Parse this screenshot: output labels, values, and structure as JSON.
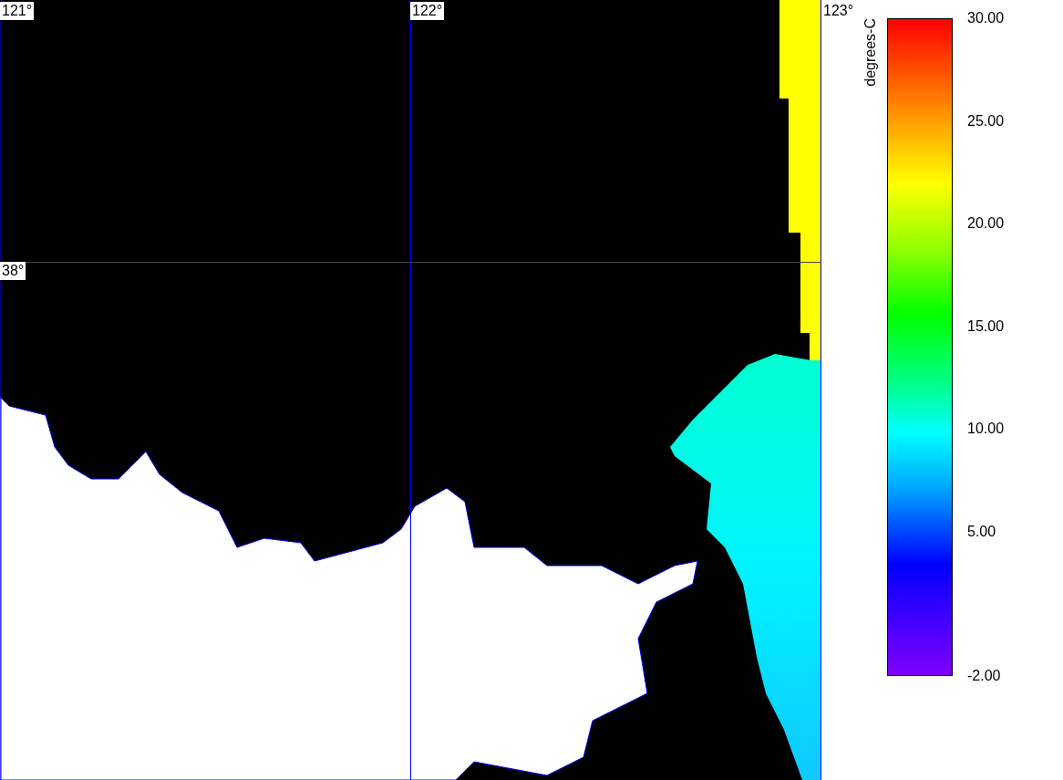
{
  "map": {
    "longitude_labels": [
      "121°",
      "122°",
      "123°"
    ],
    "latitude_labels": [
      "38°"
    ]
  },
  "color_scale": {
    "unit": "degrees-C",
    "labels": [
      "30.00",
      "25.00",
      "20.00",
      "15.00",
      "10.00",
      "5.00",
      "-2.00"
    ]
  }
}
